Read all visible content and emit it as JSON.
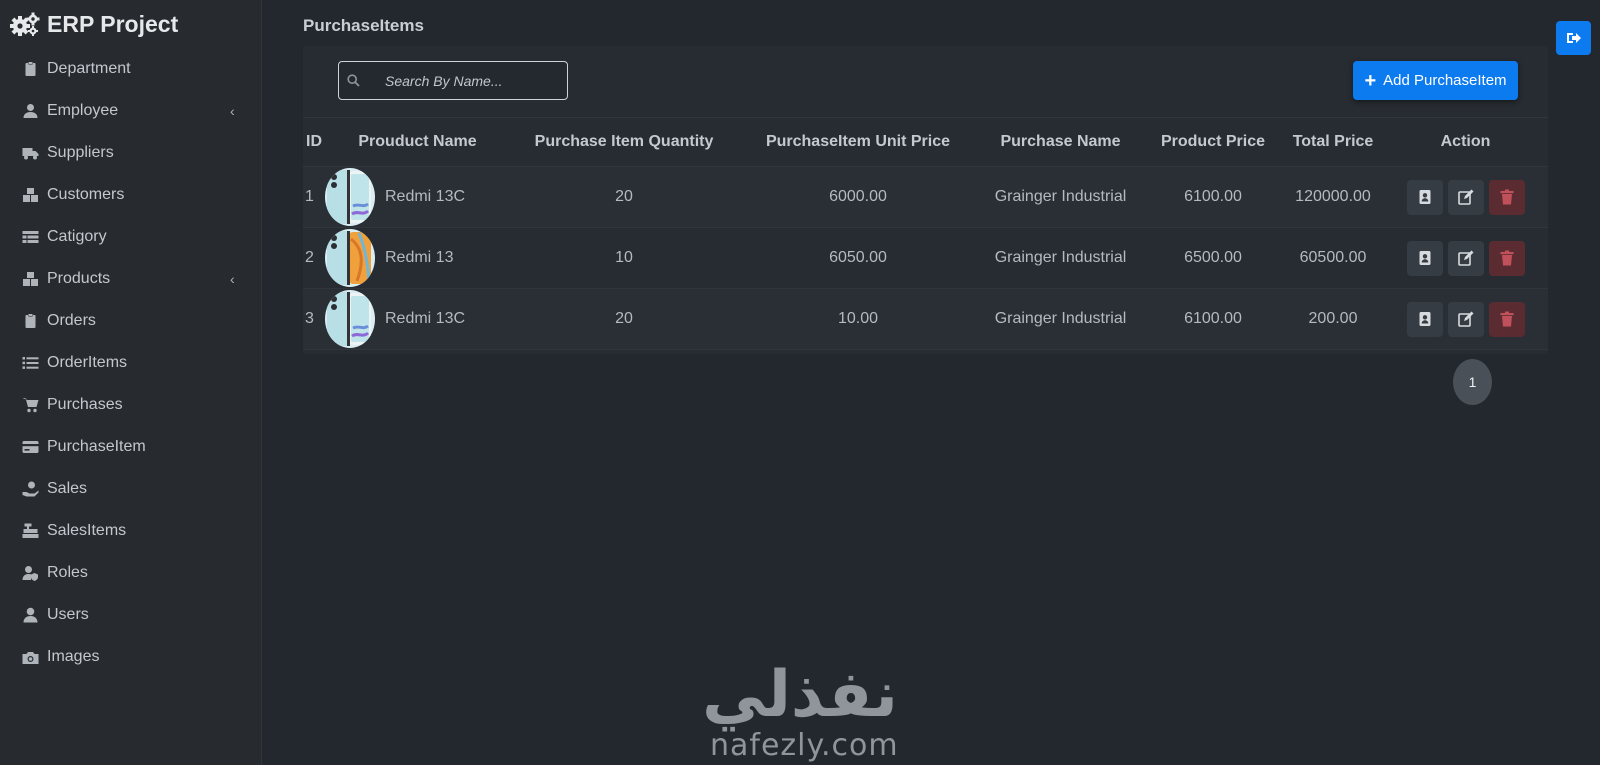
{
  "app": {
    "brand": "ERP Project",
    "page_title": "PurchaseItems"
  },
  "sidebar": {
    "items": [
      {
        "label": "Department",
        "icon": "clipboard-icon",
        "has_submenu": false
      },
      {
        "label": "Employee",
        "icon": "user-tie-icon",
        "has_submenu": true
      },
      {
        "label": "Suppliers",
        "icon": "truck-icon",
        "has_submenu": false
      },
      {
        "label": "Customers",
        "icon": "boxes-icon",
        "has_submenu": false
      },
      {
        "label": "Catigory",
        "icon": "table-icon",
        "has_submenu": false
      },
      {
        "label": "Products",
        "icon": "boxes-icon",
        "has_submenu": true
      },
      {
        "label": "Orders",
        "icon": "clipboard-icon",
        "has_submenu": false
      },
      {
        "label": "OrderItems",
        "icon": "list-icon",
        "has_submenu": false
      },
      {
        "label": "Purchases",
        "icon": "cart-icon",
        "has_submenu": false
      },
      {
        "label": "PurchaseItem",
        "icon": "credit-card-icon",
        "has_submenu": false
      },
      {
        "label": "Sales",
        "icon": "hand-dollar-icon",
        "has_submenu": false
      },
      {
        "label": "SalesItems",
        "icon": "cash-register-icon",
        "has_submenu": false
      },
      {
        "label": "Roles",
        "icon": "user-shield-icon",
        "has_submenu": false
      },
      {
        "label": "Users",
        "icon": "user-icon",
        "has_submenu": false
      },
      {
        "label": "Images",
        "icon": "camera-icon",
        "has_submenu": false
      }
    ],
    "chevron": "‹"
  },
  "toolbar": {
    "search_placeholder": "Search By Name...",
    "add_label": "Add PurchaseItem",
    "add_plus": "+"
  },
  "table": {
    "headers": [
      "ID",
      "Prouduct Name",
      "Purchase Item Quantity",
      "PurchaseItem Unit Price",
      "Purchase Name",
      "Product Price",
      "Total Price",
      "Action"
    ],
    "rows": [
      {
        "id": "1",
        "product": "Redmi 13C",
        "qty": "20",
        "unit_price": "6000.00",
        "purchase": "Grainger Industrial",
        "product_price": "6100.00",
        "total": "120000.00",
        "image": "redmi-13c"
      },
      {
        "id": "2",
        "product": "Redmi 13",
        "qty": "10",
        "unit_price": "6050.00",
        "purchase": "Grainger Industrial",
        "product_price": "6500.00",
        "total": "60500.00",
        "image": "redmi-13"
      },
      {
        "id": "3",
        "product": "Redmi 13C",
        "qty": "20",
        "unit_price": "10.00",
        "purchase": "Grainger Industrial",
        "product_price": "6100.00",
        "total": "200.00",
        "image": "redmi-13c"
      }
    ]
  },
  "pagination": {
    "current": "1"
  },
  "watermark": {
    "arabic": "نفذلي",
    "latin": "nafezly.com"
  },
  "colors": {
    "primary": "#0d7bf0",
    "danger_bg": "#5a2c31",
    "danger_icon": "#c0505a",
    "background": "#23272e",
    "sidebar": "#272b30"
  }
}
